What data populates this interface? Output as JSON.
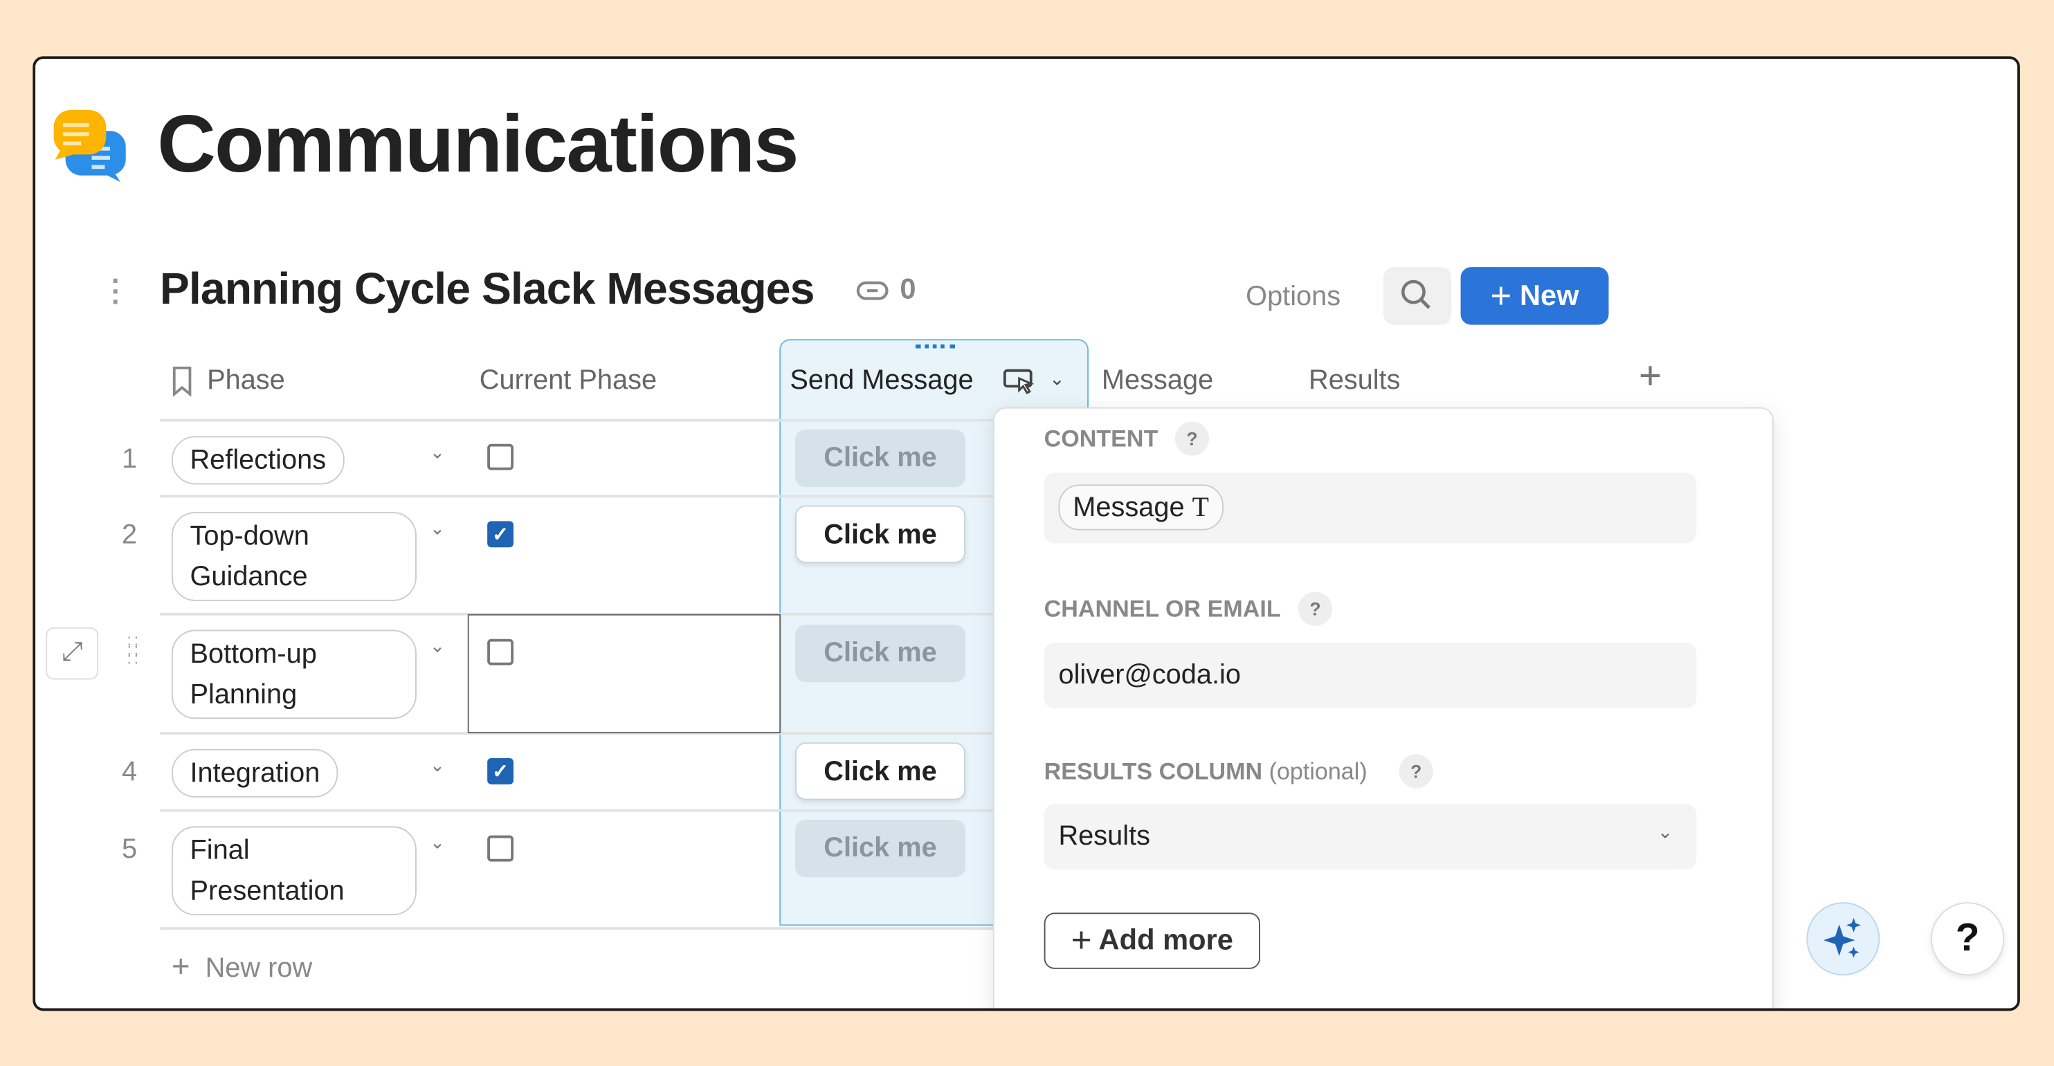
{
  "page": {
    "title": "Communications",
    "icon": "chat-bubbles-icon"
  },
  "table": {
    "title": "Planning Cycle Slack Messages",
    "link_count": "0",
    "options_label": "Options",
    "new_label": "New",
    "columns": [
      "Phase",
      "Current Phase",
      "Send Message",
      "Message",
      "Results"
    ],
    "rows": [
      {
        "num": "1",
        "phase": "Reflections",
        "current": false,
        "button": "Click me",
        "enabled": false
      },
      {
        "num": "2",
        "phase": "Top-down Guidance",
        "current": true,
        "button": "Click me",
        "enabled": true
      },
      {
        "num": "",
        "phase": "Bottom-up Planning",
        "current": false,
        "button": "Click me",
        "enabled": false
      },
      {
        "num": "4",
        "phase": "Integration",
        "current": true,
        "button": "Click me",
        "enabled": true
      },
      {
        "num": "5",
        "phase": "Final Presentation",
        "current": false,
        "button": "Click me",
        "enabled": false
      }
    ],
    "new_row_label": "New row"
  },
  "popup": {
    "content_label": "CONTENT",
    "content_chip": "Message",
    "content_chip_icon": "T",
    "channel_label": "CHANNEL OR EMAIL",
    "channel_value": "oliver@coda.io",
    "results_label": "RESULTS COLUMN",
    "results_optional": "(optional)",
    "results_value": "Results",
    "add_more_label": "Add more",
    "help_glyph": "?"
  },
  "colors": {
    "accent": "#2b74d9",
    "background": "#fde6c9",
    "column_highlight": "#e8f3fa",
    "checkbox": "#1f64b5"
  },
  "help_button": "?"
}
